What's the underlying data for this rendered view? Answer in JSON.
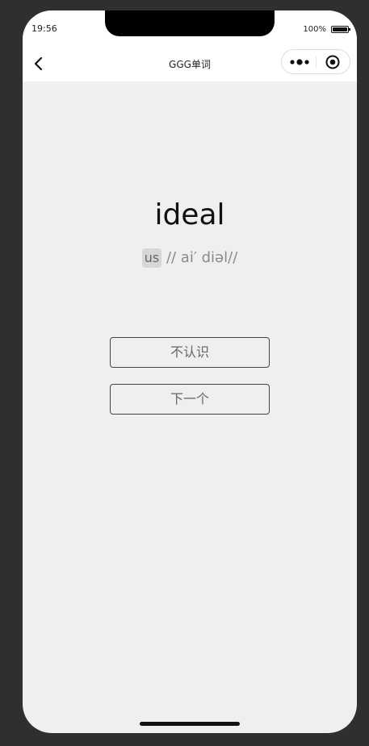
{
  "status": {
    "time": "19:56",
    "battery": "100%"
  },
  "nav": {
    "title": "GGG单词",
    "back_icon": "chevron-left-icon",
    "more_icon": "more-dots-icon",
    "close_icon": "target-circle-icon"
  },
  "word": {
    "text": "ideal",
    "region": "us",
    "phonetic": "// ai′  diəl//"
  },
  "buttons": {
    "unknown": "不认识",
    "next": "下一个"
  }
}
